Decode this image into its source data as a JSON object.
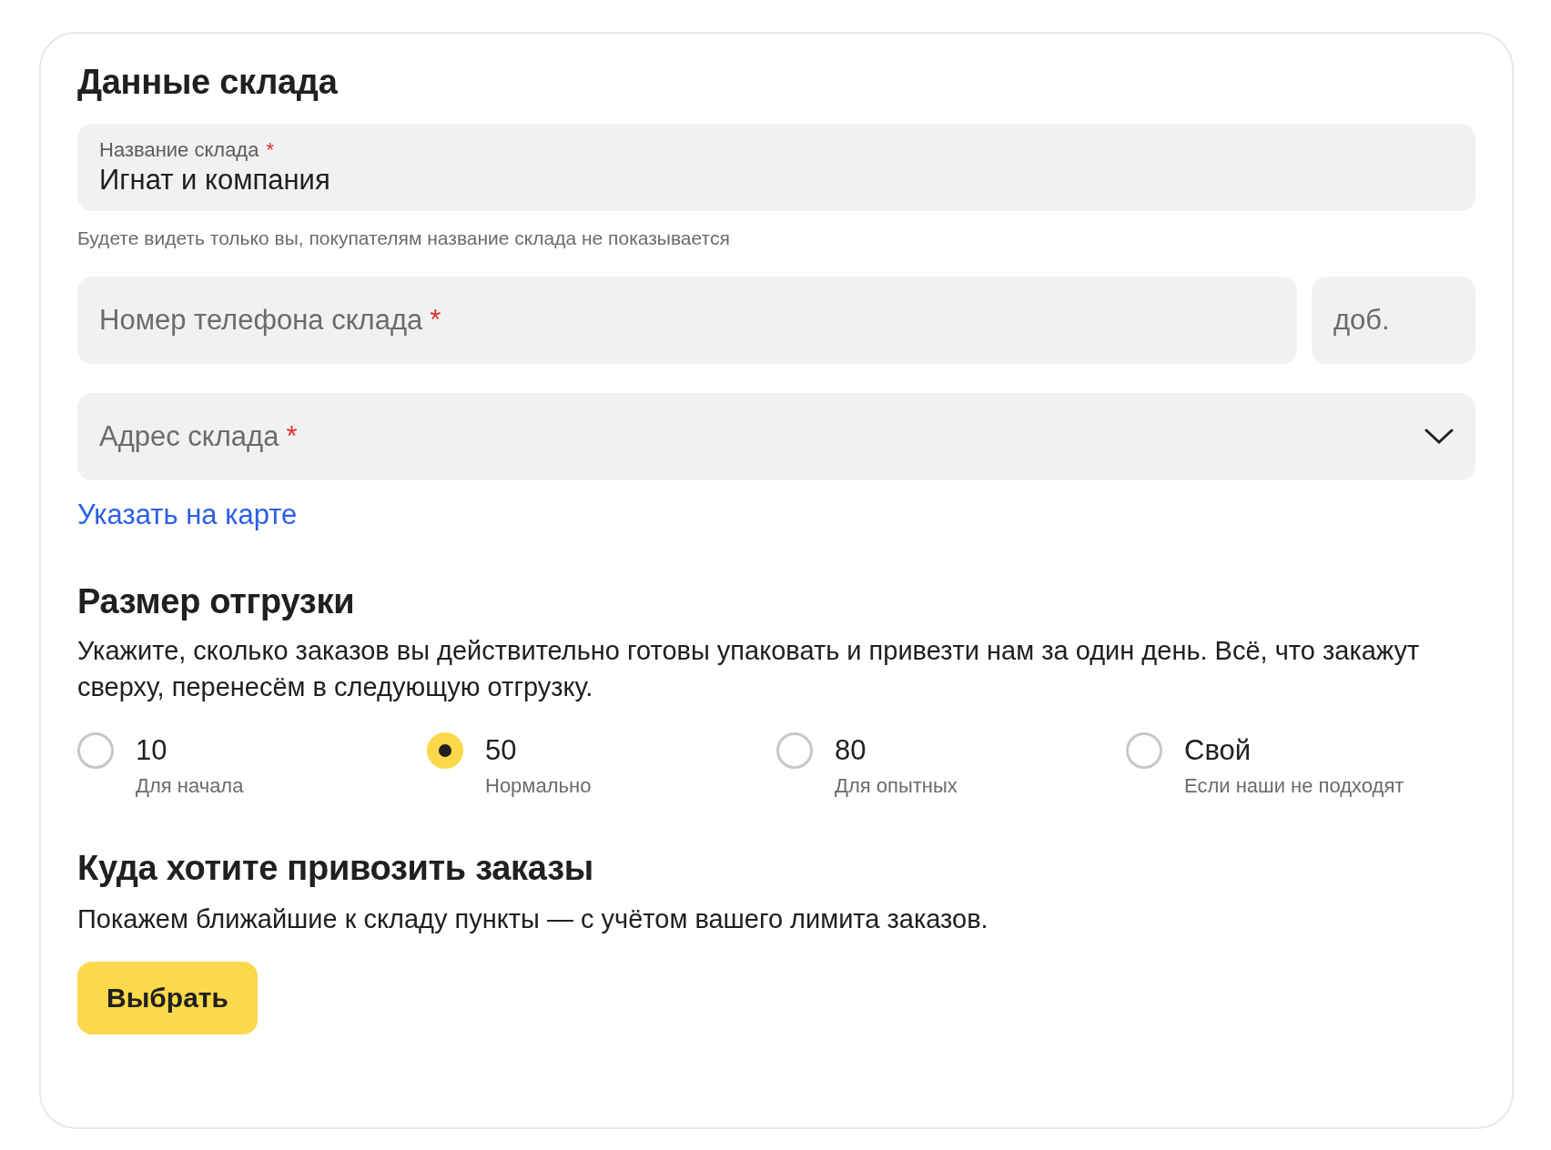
{
  "title": "Данные склада",
  "name_field": {
    "label": "Название склада",
    "required_mark": "*",
    "value": "Игнат и компания",
    "hint": "Будете видеть только вы, покупателям название склада не показывается"
  },
  "phone_field": {
    "placeholder": "Номер телефона склада",
    "required_mark": "*"
  },
  "extension_field": {
    "placeholder": "доб."
  },
  "address_field": {
    "placeholder": "Адрес склада",
    "required_mark": "*"
  },
  "map_link": "Указать на карте",
  "shipment": {
    "heading": "Размер отгрузки",
    "description": "Укажите, сколько заказов вы действительно готовы упаковать и привезти нам за один день. Всё, что закажут сверху, перенесём в следующую отгрузку.",
    "options": [
      {
        "value": "10",
        "caption": "Для начала",
        "selected": false
      },
      {
        "value": "50",
        "caption": "Нормально",
        "selected": true
      },
      {
        "value": "80",
        "caption": "Для опытных",
        "selected": false
      },
      {
        "value": "Свой",
        "caption": "Если наши не подходят",
        "selected": false
      }
    ]
  },
  "delivery": {
    "heading": "Куда хотите привозить заказы",
    "description": "Покажем ближайшие к складу пункты — с учётом вашего лимита заказов.",
    "button": "Выбрать"
  }
}
